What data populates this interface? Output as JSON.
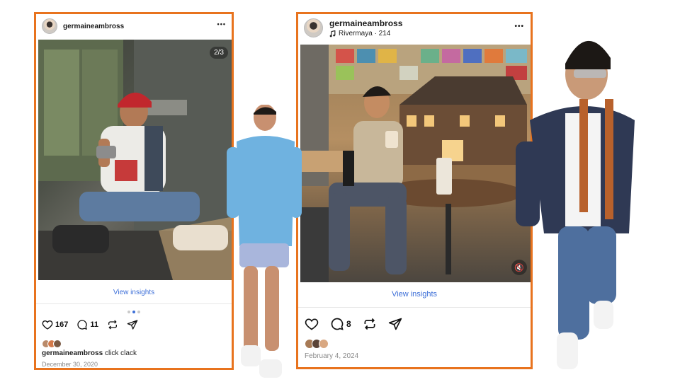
{
  "post1": {
    "username": "germaineambross",
    "more_label": "•••",
    "photo_counter": "2/3",
    "view_insights": "View insights",
    "likes": "167",
    "comments": "11",
    "caption_user": "germaineambross",
    "caption_text": "click clack",
    "date": "December 30, 2020",
    "carousel_total": 3,
    "carousel_index": 2
  },
  "post2": {
    "username": "germaineambross",
    "music_icon": "music-note-icon",
    "music_label": "Rivermaya · 214",
    "more_label": "•••",
    "view_insights": "View insights",
    "comments": "8",
    "mute_icon": "speaker-muted-icon",
    "date": "February 4, 2024"
  },
  "colors": {
    "card_border": "#e8731e",
    "link_blue": "#3d6fd8",
    "date_grey": "#8a8a8a"
  },
  "icons": [
    "heart-icon",
    "comment-icon",
    "repost-icon",
    "share-icon"
  ]
}
